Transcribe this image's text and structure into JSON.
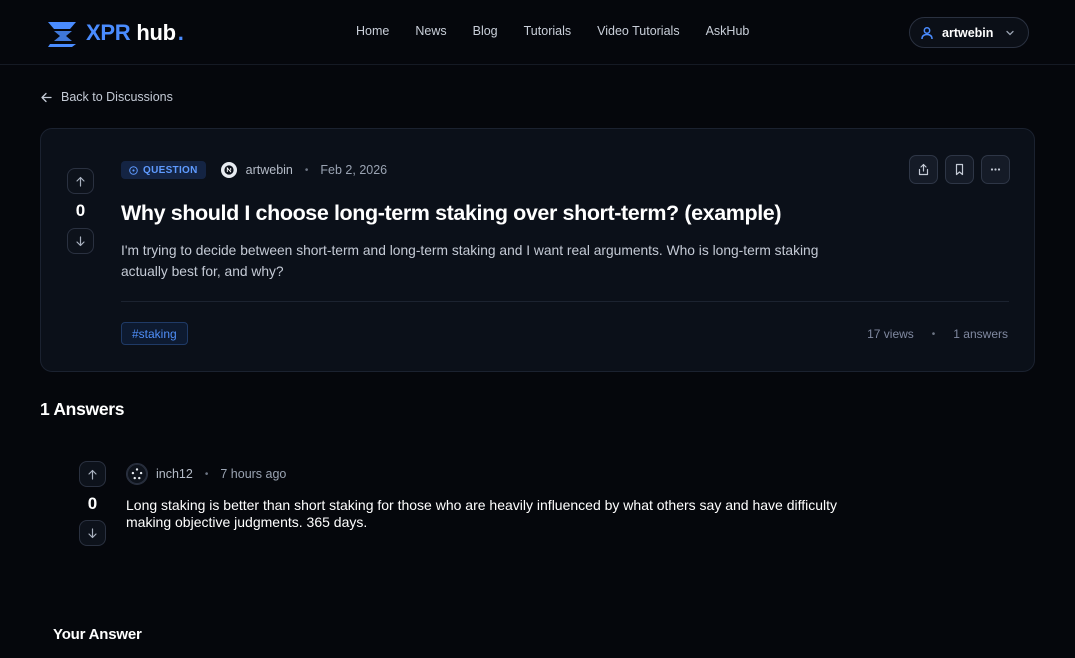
{
  "brand": {
    "name_part1": "XPR",
    "name_part2": "hub",
    "name_dot": ".",
    "accent_color": "#4a8cff"
  },
  "nav": {
    "items": [
      {
        "label": "Home"
      },
      {
        "label": "News"
      },
      {
        "label": "Blog"
      },
      {
        "label": "Tutorials"
      },
      {
        "label": "Video Tutorials"
      },
      {
        "label": "AskHub"
      }
    ]
  },
  "user_menu": {
    "username": "artwebin",
    "icons": {
      "user": "user-icon",
      "expand": "chevron-down-icon"
    }
  },
  "back_link": {
    "label": "Back to Discussions",
    "icon": "arrow-left-icon"
  },
  "question": {
    "badge": "QUESTION",
    "author": "artwebin",
    "date": "Feb 2, 2026",
    "votes": "0",
    "title": "Why should I choose long-term staking over short-term? (example)",
    "body": "I'm trying to decide between short-term and long-term staking and I want real arguments. Who is long-term staking actually best for, and why?",
    "tag": "#staking",
    "views": "17 views",
    "answers_count": "1 answers",
    "separator": "•",
    "actions": [
      "share-icon",
      "bookmark-icon",
      "more-icon"
    ]
  },
  "answers_section": {
    "title": "1 Answers",
    "items": [
      {
        "author": "inch12",
        "time": "7 hours ago",
        "votes": "0",
        "body": "Long staking is better than short staking for those who are heavily influenced by what others say and have difficulty making objective judgments. 365 days."
      }
    ]
  },
  "your_answer": {
    "title": "Your Answer"
  }
}
